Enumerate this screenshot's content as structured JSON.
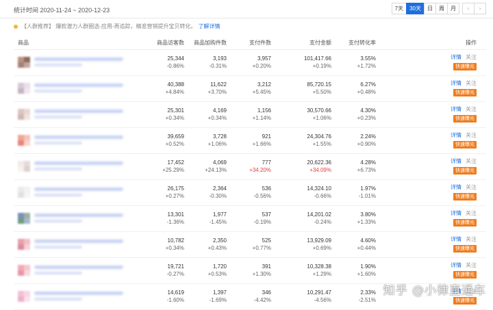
{
  "header": {
    "range_label": "统计时间 2020-11-24 ~ 2020-12-23",
    "range_buttons": [
      "7天",
      "30天",
      "日",
      "周",
      "月"
    ],
    "active_range": "30天",
    "prev_icon": "chevron-left-icon",
    "next_icon": "chevron-right-icon"
  },
  "tip": {
    "text": "【人群推荐】 爆款潜力人群圈选-应用-再追踪，精准营销提升宝贝转化。",
    "link": "了解详情",
    "dot_color": "#f5b335"
  },
  "columns": [
    "商品",
    "商品访客数",
    "商品加购件数",
    "支付件数",
    "支付金额",
    "支付转化率",
    "操作"
  ],
  "actions": {
    "detail": "详情",
    "follow": "关注",
    "boost": "快速曝光"
  },
  "rows": [
    {
      "visitors": "25,344",
      "visitors_d": "-0.86%",
      "cart": "3,193",
      "cart_d": "-0.31%",
      "pay": "3,957",
      "pay_d": "+0.20%",
      "amount": "101,417.66",
      "amount_d": "+0.19%",
      "rate": "3.55%",
      "rate_d": "+1.72%",
      "colors": [
        "#b89485",
        "#8c6a5c",
        "#a5807a",
        "#c4a79c"
      ]
    },
    {
      "visitors": "40,388",
      "visitors_d": "+4.84%",
      "cart": "11,622",
      "cart_d": "+3.70%",
      "pay": "3,212",
      "pay_d": "+5.45%",
      "amount": "85,720.15",
      "amount_d": "+5.50%",
      "rate": "6.27%",
      "rate_d": "+0.48%",
      "colors": [
        "#d9c8d6",
        "#eadfe8",
        "#c7b3c4",
        "#f0e7ee"
      ]
    },
    {
      "visitors": "25,301",
      "visitors_d": "+0.34%",
      "cart": "4,169",
      "cart_d": "+0.34%",
      "pay": "1,156",
      "pay_d": "+1.14%",
      "amount": "30,570.66",
      "amount_d": "+1.06%",
      "rate": "4.30%",
      "rate_d": "+0.23%",
      "colors": [
        "#dcc6c1",
        "#e8d8d4",
        "#d2b7b0",
        "#efe3e0"
      ]
    },
    {
      "visitors": "39,659",
      "visitors_d": "+0.52%",
      "cart": "3,728",
      "cart_d": "+1.06%",
      "pay": "921",
      "pay_d": "+1.66%",
      "amount": "24,304.76",
      "amount_d": "+1.55%",
      "rate": "2.24%",
      "rate_d": "+0.90%",
      "colors": [
        "#f1a596",
        "#f5c2b6",
        "#e8857a",
        "#f7d6cd"
      ]
    },
    {
      "visitors": "17,452",
      "visitors_d": "+25.29%",
      "cart": "4,069",
      "cart_d": "+24.13%",
      "pay": "777",
      "pay_d": "+34.20%",
      "pay_hl": true,
      "amount": "20,622.36",
      "amount_d": "+34.09%",
      "amount_hl": true,
      "rate": "4.28%",
      "rate_d": "+6.73%",
      "colors": [
        "#f2ebe9",
        "#e6dcda",
        "#f7f1ef",
        "#ddd1ce"
      ]
    },
    {
      "visitors": "26,175",
      "visitors_d": "+0.27%",
      "cart": "2,364",
      "cart_d": "-0.30%",
      "pay": "536",
      "pay_d": "-0.56%",
      "amount": "14,324.10",
      "amount_d": "-0.66%",
      "rate": "1.97%",
      "rate_d": "-1.01%",
      "colors": [
        "#ece9ea",
        "#f3f1f2",
        "#e3dfe1",
        "#f6f4f5"
      ]
    },
    {
      "visitors": "13,301",
      "visitors_d": "-1.36%",
      "cart": "1,977",
      "cart_d": "-1.45%",
      "pay": "537",
      "pay_d": "-0.19%",
      "amount": "14,201.02",
      "amount_d": "-0.24%",
      "rate": "3.80%",
      "rate_d": "+1.33%",
      "colors": [
        "#7d8fb8",
        "#9cb0a0",
        "#6f9c82",
        "#a8b8cf"
      ]
    },
    {
      "visitors": "10,782",
      "visitors_d": "+0.34%",
      "cart": "2,350",
      "cart_d": "+0.43%",
      "pay": "525",
      "pay_d": "+0.77%",
      "amount": "13,929.09",
      "amount_d": "+0.69%",
      "rate": "4.60%",
      "rate_d": "+0.44%",
      "colors": [
        "#e8a0ad",
        "#f0bec8",
        "#dd8a9a",
        "#f5d2d9"
      ]
    },
    {
      "visitors": "19,721",
      "visitors_d": "-0.27%",
      "cart": "1,720",
      "cart_d": "+0.53%",
      "pay": "391",
      "pay_d": "+1.30%",
      "amount": "10,328.38",
      "amount_d": "+1.29%",
      "rate": "1.90%",
      "rate_d": "+1.60%",
      "colors": [
        "#f0aab6",
        "#f5c5ce",
        "#e897a5",
        "#f8d8de"
      ]
    },
    {
      "visitors": "14,619",
      "visitors_d": "-1.60%",
      "cart": "1,397",
      "cart_d": "-1.69%",
      "pay": "346",
      "pay_d": "-4.42%",
      "amount": "10,291.47",
      "amount_d": "-4.56%",
      "rate": "2.33%",
      "rate_d": "-2.51%",
      "colors": [
        "#f3c1d6",
        "#f7d7e5",
        "#eeb0c9",
        "#f9e3ed"
      ]
    }
  ],
  "watermark": "知乎 @小律直通车"
}
